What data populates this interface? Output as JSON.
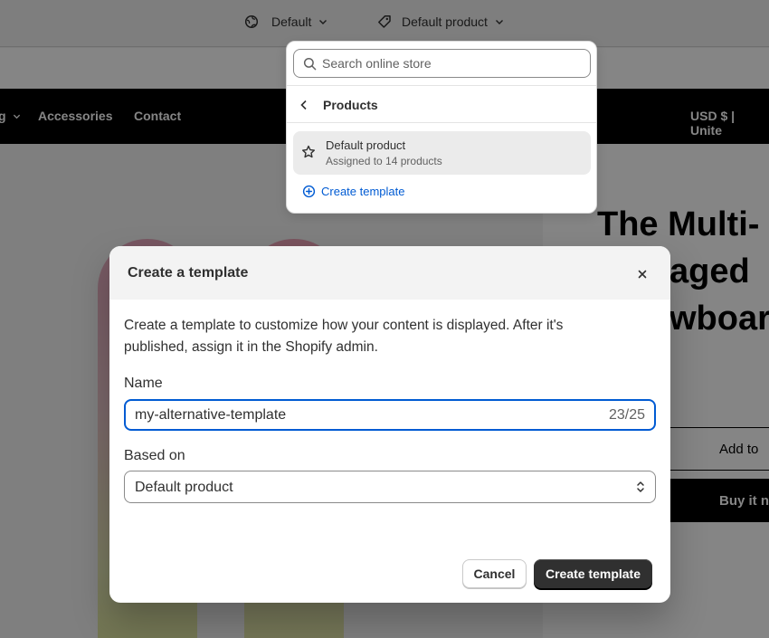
{
  "topbar": {
    "theme_label": "Default",
    "template_label": "Default product",
    "icons": [
      "globe-icon",
      "chevron-down-icon",
      "tag-icon",
      "chevron-down-icon"
    ]
  },
  "storefront": {
    "nav": {
      "partial_item": "g",
      "items": [
        "Accessories",
        "Contact"
      ],
      "currency": "USD $ | Unite"
    },
    "product": {
      "title_lines": [
        "The Multi-",
        "aged",
        "wboar"
      ],
      "add_to_cart": "Add to",
      "buy_now": "Buy it n"
    }
  },
  "dropdown": {
    "search_placeholder": "Search online store",
    "back_label": "Products",
    "option": {
      "name": "Default product",
      "subtitle": "Assigned to 14 products"
    },
    "create_label": "Create template",
    "link_color": "#005bd3"
  },
  "modal": {
    "title": "Create a template",
    "description": "Create a template to customize how your content is displayed. After it's published, assign it in the Shopify admin.",
    "name_label": "Name",
    "name_value": "my-alternative-template",
    "name_counter": "23/25",
    "based_on_label": "Based on",
    "based_on_value": "Default product",
    "cancel_label": "Cancel",
    "create_label": "Create template",
    "focus_color": "#005bd3",
    "primary_color": "#303030"
  }
}
